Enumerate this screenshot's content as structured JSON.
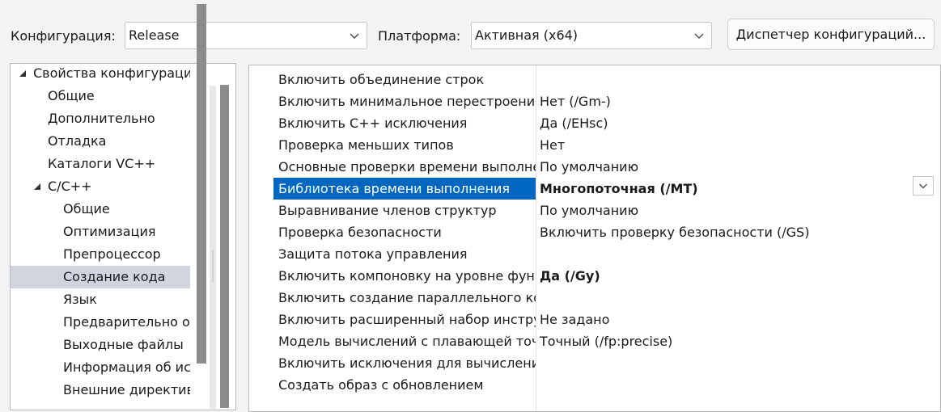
{
  "toolbar": {
    "config_label": "Конфигурация:",
    "config_value": "Release",
    "platform_label": "Платформа:",
    "platform_value": "Активная (x64)",
    "manager_button": "Диспетчер конфигураций..."
  },
  "tree": [
    {
      "label": "Свойства конфигурации",
      "level": 0,
      "expanded": true,
      "selected": false
    },
    {
      "label": "Общие",
      "level": 1,
      "selected": false
    },
    {
      "label": "Дополнительно",
      "level": 1,
      "selected": false
    },
    {
      "label": "Отладка",
      "level": 1,
      "selected": false
    },
    {
      "label": "Каталоги VC++",
      "level": 1,
      "selected": false
    },
    {
      "label": "C/C++",
      "level": 1,
      "expanded": true,
      "selected": false
    },
    {
      "label": "Общие",
      "level": 2,
      "selected": false
    },
    {
      "label": "Оптимизация",
      "level": 2,
      "selected": false
    },
    {
      "label": "Препроцессор",
      "level": 2,
      "selected": false
    },
    {
      "label": "Создание кода",
      "level": 2,
      "selected": true
    },
    {
      "label": "Язык",
      "level": 2,
      "selected": false
    },
    {
      "label": "Предварительно от",
      "level": 2,
      "selected": false
    },
    {
      "label": "Выходные файлы",
      "level": 2,
      "selected": false
    },
    {
      "label": "Информация об ис",
      "level": 2,
      "selected": false
    },
    {
      "label": "Внешние директивы",
      "level": 2,
      "selected": false
    }
  ],
  "properties": [
    {
      "name": "Включить объединение строк",
      "value": "",
      "bold": false,
      "selected": false
    },
    {
      "name": "Включить минимальное перестроение",
      "value": "Нет (/Gm-)",
      "bold": false,
      "selected": false
    },
    {
      "name": "Включить C++ исключения",
      "value": "Да (/EHsc)",
      "bold": false,
      "selected": false
    },
    {
      "name": "Проверка меньших типов",
      "value": "Нет",
      "bold": false,
      "selected": false
    },
    {
      "name": "Основные проверки времени выполнения",
      "value": "По умолчанию",
      "bold": false,
      "selected": false
    },
    {
      "name": "Библиотека времени выполнения",
      "value": "Многопоточная (/MT)",
      "bold": true,
      "selected": true
    },
    {
      "name": "Выравнивание членов структур",
      "value": "По умолчанию",
      "bold": false,
      "selected": false
    },
    {
      "name": "Проверка безопасности",
      "value": "Включить проверку безопасности (/GS)",
      "bold": false,
      "selected": false
    },
    {
      "name": "Защита потока управления",
      "value": "",
      "bold": false,
      "selected": false
    },
    {
      "name": "Включить компоновку на уровне функций",
      "value": "Да (/Gy)",
      "bold": true,
      "selected": false
    },
    {
      "name": "Включить создание параллельного кода",
      "value": "",
      "bold": false,
      "selected": false
    },
    {
      "name": "Включить расширенный набор инструкций",
      "value": "Не задано",
      "bold": false,
      "selected": false
    },
    {
      "name": "Модель вычислений с плавающей точкой",
      "value": "Точный (/fp:precise)",
      "bold": false,
      "selected": false
    },
    {
      "name": "Включить исключения для вычислений с плавающей точкой",
      "value": "",
      "bold": false,
      "selected": false
    },
    {
      "name": "Создать образ с обновлением",
      "value": "",
      "bold": false,
      "selected": false
    }
  ],
  "icons": {
    "combo_chevron": "chevron-down-icon",
    "tree_caret": "expanded-caret-icon"
  },
  "colors": {
    "selection_blue": "#0067c0",
    "tree_selection": "#d1d5e0"
  }
}
